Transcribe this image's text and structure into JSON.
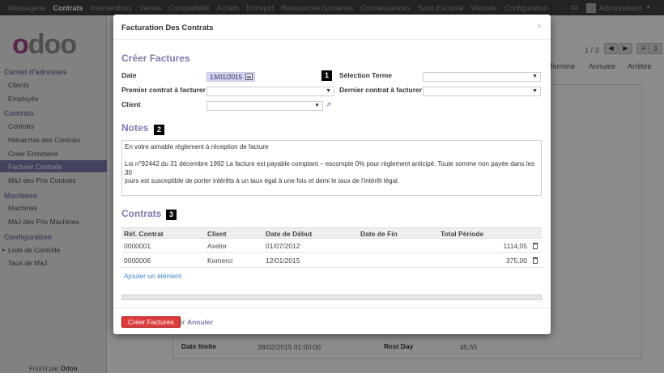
{
  "topbar": {
    "menus": [
      "Messagerie",
      "Contrats",
      "Interventions",
      "Ventes",
      "Comptabilité",
      "Achats",
      "Entrepôt",
      "Ressources humaines",
      "Connaissances",
      "Suivi d'activité",
      "Website",
      "Configuration"
    ],
    "user": "Administrator"
  },
  "sidebar": {
    "logo": "odoo",
    "sections": [
      {
        "title": "Carnet d'adresses",
        "items": [
          "Clients",
          "Employés"
        ]
      },
      {
        "title": "Contrats",
        "items": [
          "Contrats",
          "Hiérarchie des Contrats",
          "Créer Entretiens",
          "Facturer Contrats",
          "MàJ des Prix Contrats"
        ]
      },
      {
        "title": "Machines",
        "items": [
          "Machines",
          "MàJ des Prix Machines"
        ]
      },
      {
        "title": "Configuration",
        "items": [
          "Liste de Contrôle",
          "Taux de MàJ"
        ]
      }
    ],
    "active_item": "Facturer Contrats",
    "powered_prefix": "Fourni par",
    "powered_brand": "Odoo"
  },
  "background": {
    "pager": "1 / 3",
    "states": [
      "Terminé",
      "Annulée",
      "Arrêtée"
    ],
    "date_limite_label": "Date limite",
    "date_limite_value": "28/02/2015 01:00:00",
    "rest_day_label": "Rest Day",
    "rest_day_value": "45.55"
  },
  "modal": {
    "title": "Facturation Des Contrats",
    "close": "×",
    "section_create": "Créer Factures",
    "labels": {
      "date": "Date",
      "premier": "Premier contrat à facturer",
      "client": "Client",
      "selection_terme": "Sélection Terme",
      "dernier": "Dernier contrat à facturer"
    },
    "date_value": "13/01/2015",
    "markers": [
      "1",
      "2",
      "3"
    ],
    "notes_title": "Notes",
    "notes_lines": [
      "En votre aimable règlement à réception de facture",
      "",
      "Loi n°92442 du 31 décembre 1992 La facture est payable comptant – escompte 0% pour règlement anticipé. Toute somme non payée dans les 30",
      "jours est susceptible de porter intérêts à un taux égal à une fois et demi le taux de l'intérêt légal."
    ],
    "contrats_title": "Contrats",
    "table": {
      "headers": [
        "Réf. Contrat",
        "Client",
        "Date de Début",
        "Date de Fin",
        "Total Période"
      ],
      "rows": [
        {
          "ref": "0000001",
          "client": "Axelor",
          "debut": "01/07/2012",
          "fin": "",
          "total": "1114,05"
        },
        {
          "ref": "0000006",
          "client": "Komerci",
          "debut": "12/01/2015",
          "fin": "",
          "total": "375,00"
        }
      ]
    },
    "add_item": "Ajouter un élément",
    "create_button": "Créer Factures",
    "or_text": "or",
    "cancel": "Annuler"
  }
}
